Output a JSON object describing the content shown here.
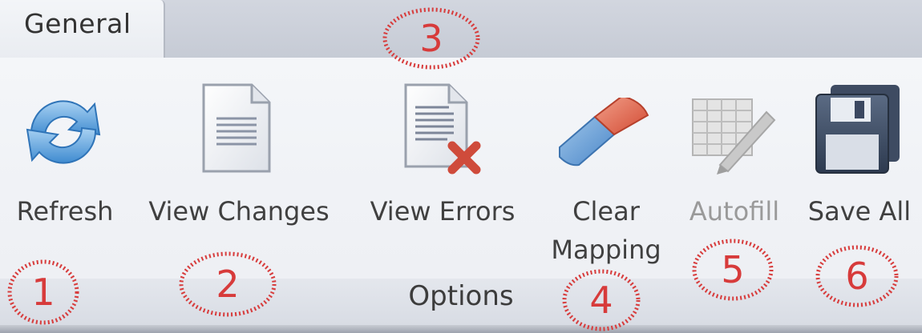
{
  "tabs": [
    {
      "label": "General",
      "active": true
    }
  ],
  "ribbon": {
    "group_label": "Options",
    "buttons": [
      {
        "label": "Refresh",
        "icon": "refresh-icon",
        "enabled": true
      },
      {
        "label": "View Changes",
        "icon": "document-icon",
        "enabled": true
      },
      {
        "label": "View Errors",
        "icon": "document-error-icon",
        "enabled": true
      },
      {
        "label_line1": "Clear",
        "label_line2": "Mapping",
        "icon": "eraser-icon",
        "enabled": true
      },
      {
        "label": "Autofill",
        "icon": "autofill-grid-icon",
        "enabled": false
      },
      {
        "label": "Save All",
        "icon": "save-all-icon",
        "enabled": true
      }
    ]
  },
  "annotations": [
    "1",
    "2",
    "3",
    "4",
    "5",
    "6"
  ],
  "colors": {
    "annotation_red": "#d73b3b",
    "tab_strip": "#ccd1da",
    "ribbon_body": "#f1f3f7",
    "disabled_text": "#9a9a9a"
  }
}
